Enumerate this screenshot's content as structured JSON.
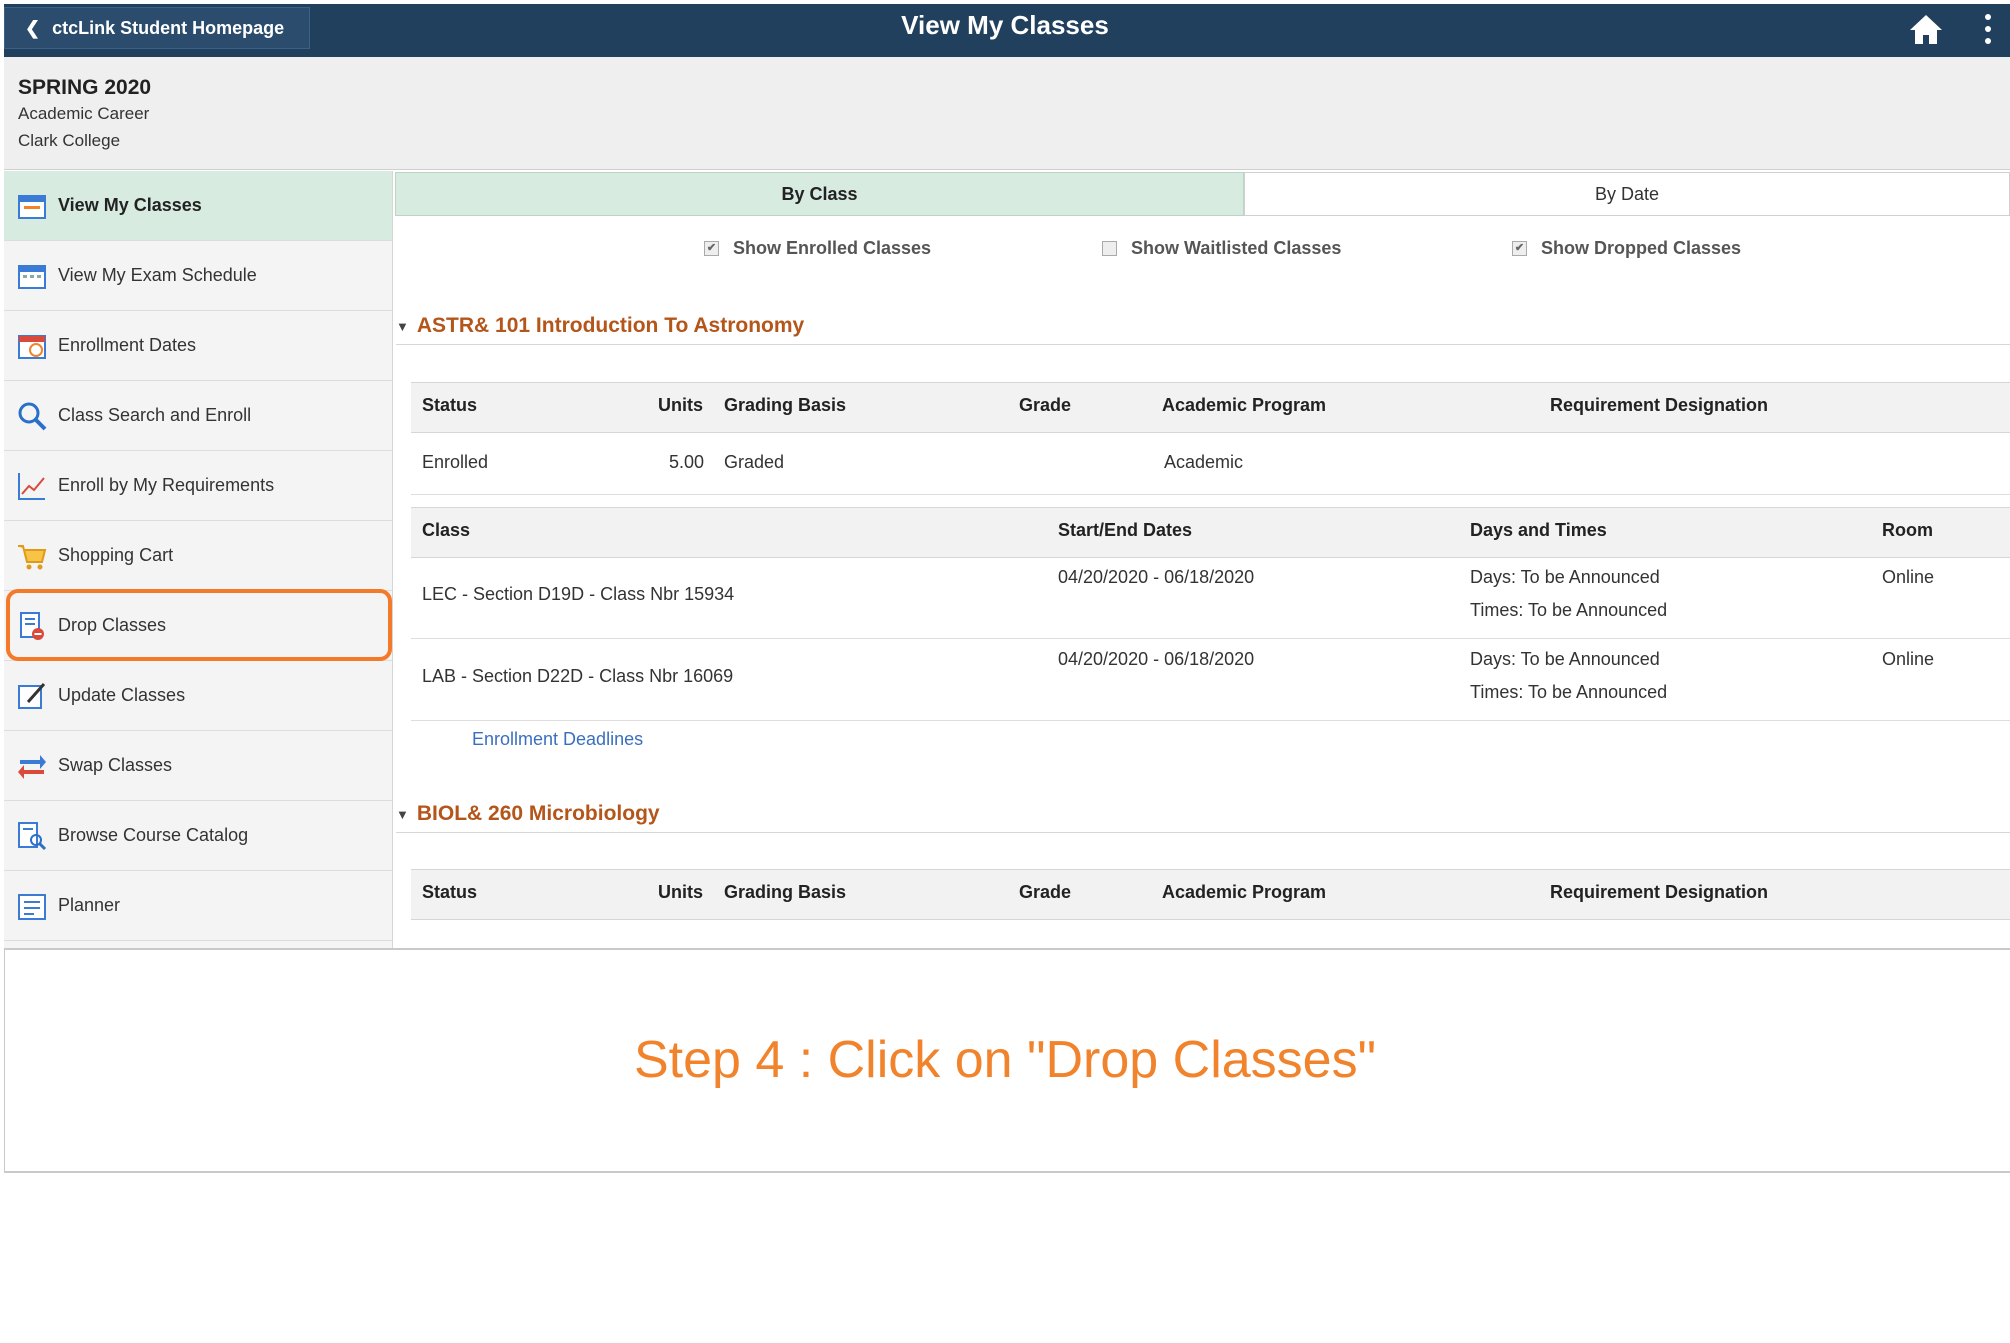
{
  "header": {
    "back_label": "ctcLink Student Homepage",
    "title": "View My Classes",
    "home_icon": "home-icon",
    "menu_icon": "vertical-dots-icon",
    "color": "#20405d"
  },
  "term": {
    "title": "SPRING 2020",
    "career": "Academic Career",
    "college": "Clark College"
  },
  "sidebar": {
    "items": [
      {
        "label": "View My Classes",
        "icon": "calendar-icon",
        "active": true
      },
      {
        "label": "View My Exam Schedule",
        "icon": "exam-calendar-icon",
        "active": false
      },
      {
        "label": "Enrollment Dates",
        "icon": "calendar-clock-icon",
        "active": false
      },
      {
        "label": "Class Search and Enroll",
        "icon": "search-icon",
        "active": false
      },
      {
        "label": "Enroll by My Requirements",
        "icon": "chart-line-icon",
        "active": false
      },
      {
        "label": "Shopping Cart",
        "icon": "cart-icon",
        "active": false
      },
      {
        "label": "Drop Classes",
        "icon": "drop-document-icon",
        "active": false
      },
      {
        "label": "Update Classes",
        "icon": "edit-document-icon",
        "active": false
      },
      {
        "label": "Swap Classes",
        "icon": "swap-arrows-icon",
        "active": false
      },
      {
        "label": "Browse Course Catalog",
        "icon": "catalog-search-icon",
        "active": false
      },
      {
        "label": "Planner",
        "icon": "planner-icon",
        "active": false
      }
    ],
    "active_color": "#d7ebe1",
    "highlight_color": "#f47a2a"
  },
  "tabs": {
    "by_class": "By Class",
    "by_date": "By Date"
  },
  "filters": {
    "enrolled": {
      "label": "Show Enrolled Classes",
      "checked": true
    },
    "waitlisted": {
      "label": "Show Waitlisted Classes",
      "checked": false
    },
    "dropped": {
      "label": "Show Dropped Classes",
      "checked": true
    }
  },
  "courses": [
    {
      "title": "ASTR& 101 Introduction To Astronomy",
      "status_headers": {
        "status": "Status",
        "units": "Units",
        "grading": "Grading Basis",
        "grade": "Grade",
        "program": "Academic Program",
        "requirement": "Requirement Designation"
      },
      "status_row": {
        "status": "Enrolled",
        "units": "5.00",
        "grading": "Graded",
        "grade": "",
        "program": "Academic",
        "requirement": ""
      },
      "class_headers": {
        "class": "Class",
        "dates": "Start/End Dates",
        "days": "Days and Times",
        "room": "Room"
      },
      "sections": [
        {
          "class": "LEC - Section D19D - Class Nbr 15934",
          "dates": "04/20/2020 - 06/18/2020",
          "days": "Days: To be Announced",
          "times": "Times: To be Announced",
          "room": "Online"
        },
        {
          "class": "LAB - Section D22D - Class Nbr 16069",
          "dates": "04/20/2020 - 06/18/2020",
          "days": "Days: To be Announced",
          "times": "Times: To be Announced",
          "room": "Online"
        }
      ],
      "deadlines_link": "Enrollment Deadlines"
    },
    {
      "title": "BIOL& 260 Microbiology",
      "status_headers": {
        "status": "Status",
        "units": "Units",
        "grading": "Grading Basis",
        "grade": "Grade",
        "program": "Academic Program",
        "requirement": "Requirement Designation"
      }
    }
  ],
  "caption": "Step 4 : Click on \"Drop Classes\"",
  "caption_color": "#f0832b"
}
